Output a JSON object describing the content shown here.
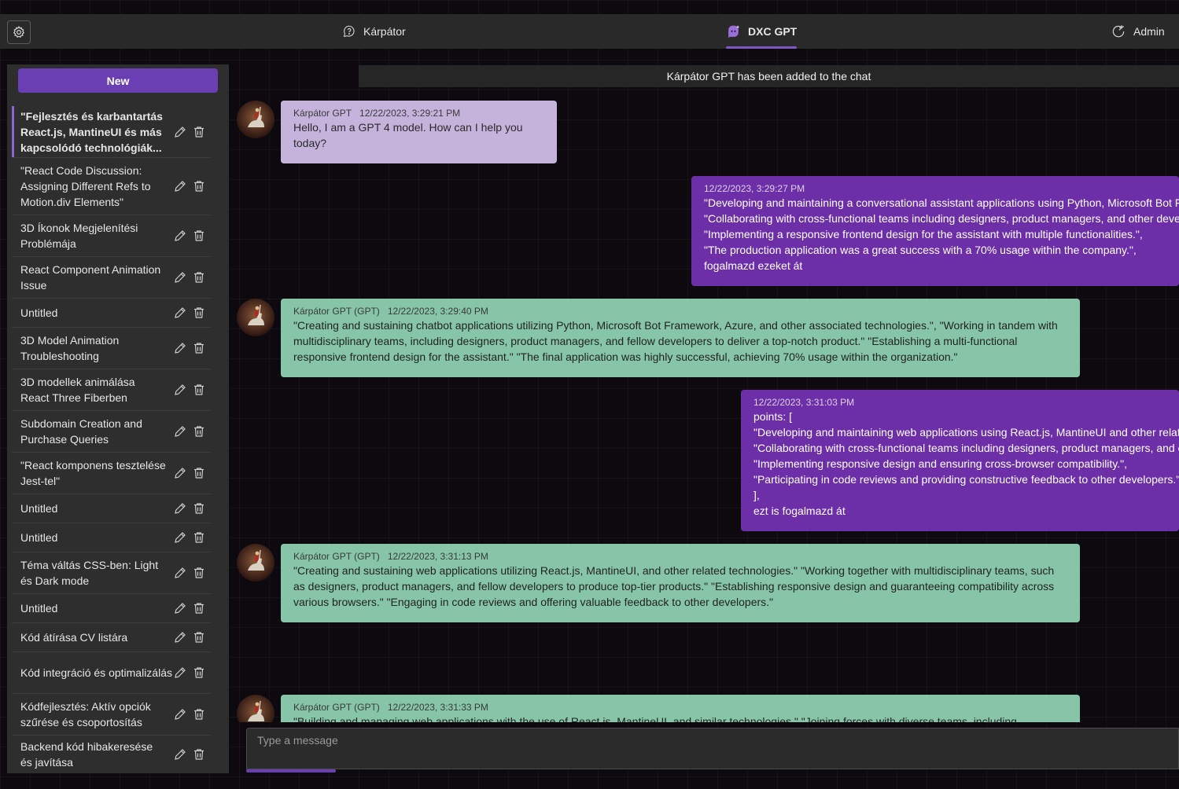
{
  "header": {
    "tabs": [
      {
        "label": "Kárpátor",
        "icon": "chat-help-icon"
      },
      {
        "label": "DXC GPT",
        "icon": "bot-sparkle-icon"
      },
      {
        "label": "Admin",
        "icon": "share-refresh-icon"
      }
    ],
    "settings_icon": "gear-icon"
  },
  "sidebar": {
    "new_label": "New",
    "conversations": [
      {
        "title": "\"Fejlesztés és karbantartás React.js, MantineUI és más kapcsolódó technológiák..."
      },
      {
        "title": "\"React Code Discussion: Assigning Different Refs to Motion.div Elements\""
      },
      {
        "title": "3D Íkonok Megjelenítési Problémája"
      },
      {
        "title": "React Component Animation Issue"
      },
      {
        "title": "Untitled"
      },
      {
        "title": "3D Model Animation Troubleshooting"
      },
      {
        "title": "3D modellek animálása React Three Fiberben"
      },
      {
        "title": "Subdomain Creation and Purchase Queries"
      },
      {
        "title": "\"React komponens tesztelése Jest-tel\""
      },
      {
        "title": "Untitled"
      },
      {
        "title": "Untitled"
      },
      {
        "title": "Téma váltás CSS-ben: Light és Dark mode"
      },
      {
        "title": "Untitled"
      },
      {
        "title": "Kód átírása CV listára"
      },
      {
        "title": "Kód integráció és optimalizálás"
      },
      {
        "title": "Kódfejlesztés: Aktív opciók szűrése és csoportosítás"
      },
      {
        "title": "Backend kód hibakeresése és javítása"
      }
    ]
  },
  "chat": {
    "system_message": "Kárpátor GPT has been added to the chat",
    "messages": [
      {
        "sender": "Kárpátor GPT",
        "time": "12/22/2023, 3:29:21 PM",
        "lines": [
          "Hello, I am a GPT 4 model. How can I help you",
          "today?"
        ]
      },
      {
        "sender": "",
        "time": "12/22/2023, 3:29:27 PM",
        "lines": [
          "\"Developing and maintaining a conversational assistant applications using Python, Microsoft Bot Framework, Azure, and other related technologies.\",",
          "\"Collaborating with cross-functional teams including designers, product managers, and other developers to deliver a high-quality product.\",",
          "\"Implementing a responsive frontend design for the assistant with multiple functionalities.\",",
          "\"The production application was a great success with a 70% usage within the company.\",",
          "fogalmazd ezeket át"
        ]
      },
      {
        "sender": "Kárpátor GPT (GPT)",
        "time": "12/22/2023, 3:29:40 PM",
        "lines": [
          "\"Creating and sustaining chatbot applications utilizing Python, Microsoft Bot Framework, Azure, and other associated technologies.\", \"Working in tandem with",
          "multidisciplinary teams, including designers, product managers, and fellow developers to deliver a top-notch product.\" \"Establishing a multi-functional",
          "responsive frontend design for the assistant.\" \"The final application was highly successful, achieving 70% usage within the organization.\""
        ]
      },
      {
        "sender": "",
        "time": "12/22/2023, 3:31:03 PM",
        "lines": [
          "points: [",
          "\"Developing and maintaining web applications using React.js, MantineUI and other related technologies.\",",
          "\"Collaborating with cross-functional teams including designers, product managers, and other developers to deliver high-quality products.\",",
          "\"Implementing responsive design and ensuring cross-browser compatibility.\",",
          "\"Participating in code reviews and providing constructive feedback to other developers.\"",
          "],",
          "ezt is fogalmazd át"
        ]
      },
      {
        "sender": "Kárpátor GPT (GPT)",
        "time": "12/22/2023, 3:31:13 PM",
        "lines": [
          "\"Creating and sustaining web applications utilizing React.js, MantineUI, and other related technologies.\" \"Working together with multidisciplinary teams, such",
          "as designers, product managers, and fellow developers to produce top-tier products.\" \"Establishing responsive design and guaranteeing compatibility across",
          "various browsers.\" \"Engaging in code reviews and offering valuable feedback to other developers.\""
        ]
      },
      {
        "sender": "Kárpátor GPT (GPT)",
        "time": "12/22/2023, 3:31:33 PM",
        "lines": [
          "\"Building and managing web applications with the use of React.js, MantineUI, and similar technologies.\" \"Joining forces with diverse teams, including designers,"
        ]
      }
    ]
  },
  "composer": {
    "placeholder": "Type a message"
  },
  "colors": {
    "accent": "#6a3fb3",
    "user_bubble": "#6d2fa8",
    "bot_first_bubble": "#c6b3dc",
    "bot_bubble": "#86c5a8"
  }
}
